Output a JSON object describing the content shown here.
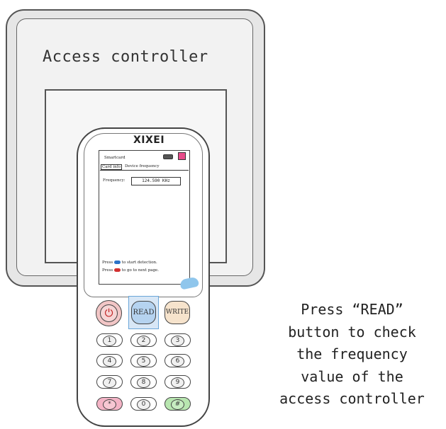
{
  "controller": {
    "title": "Access controller"
  },
  "handheld": {
    "brand": "XIXEI",
    "screen": {
      "header_label": "Smartcard",
      "tabs": [
        "Card info",
        "Device frequency"
      ],
      "frequency_label": "Frequency:",
      "frequency_value": "124.590 KHz",
      "hint_line1_prefix": "Press",
      "hint_line1_suffix": "to start detection.",
      "hint_line2_prefix": "Press",
      "hint_line2_suffix": "to go to next page."
    },
    "buttons": {
      "power_symbol": "⏻",
      "read": "READ",
      "write": "WRITE"
    },
    "keypad": [
      "1",
      "2",
      "3",
      "4",
      "5",
      "6",
      "7",
      "8",
      "9",
      "*",
      "0",
      "#"
    ]
  },
  "caption": {
    "lines": [
      "Press “READ”",
      "button to check",
      "the frequency",
      "value of the",
      "access controller"
    ]
  },
  "colors": {
    "read_button": "#b5d3f0",
    "write_button": "#f6e3cc",
    "power_button": "#f2c6c6",
    "star_key": "#f4b4c6",
    "hash_key": "#b8e6b0",
    "finger": "#8fc6ec"
  }
}
